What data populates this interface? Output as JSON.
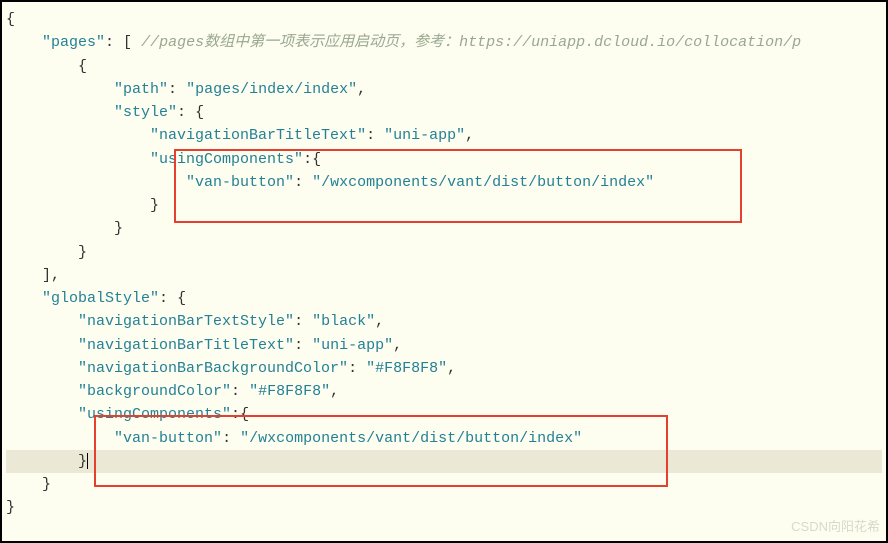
{
  "code": {
    "lines": [
      {
        "indent": 0,
        "tokens": [
          {
            "t": "punct",
            "v": "{"
          }
        ]
      },
      {
        "indent": 1,
        "tokens": [
          {
            "t": "key",
            "v": "\"pages\""
          },
          {
            "t": "colon",
            "v": ": "
          },
          {
            "t": "punct",
            "v": "[ "
          },
          {
            "t": "comment",
            "v": "//pages数组中第一项表示应用启动页，参考：https://uniapp.dcloud.io/collocation/p"
          }
        ]
      },
      {
        "indent": 2,
        "tokens": [
          {
            "t": "punct",
            "v": "{"
          }
        ]
      },
      {
        "indent": 3,
        "tokens": [
          {
            "t": "key",
            "v": "\"path\""
          },
          {
            "t": "colon",
            "v": ": "
          },
          {
            "t": "string",
            "v": "\"pages/index/index\""
          },
          {
            "t": "punct",
            "v": ","
          }
        ]
      },
      {
        "indent": 3,
        "tokens": [
          {
            "t": "key",
            "v": "\"style\""
          },
          {
            "t": "colon",
            "v": ": "
          },
          {
            "t": "punct",
            "v": "{"
          }
        ]
      },
      {
        "indent": 4,
        "tokens": [
          {
            "t": "key",
            "v": "\"navigationBarTitleText\""
          },
          {
            "t": "colon",
            "v": ": "
          },
          {
            "t": "string",
            "v": "\"uni-app\""
          },
          {
            "t": "punct",
            "v": ","
          }
        ]
      },
      {
        "indent": 4,
        "tokens": [
          {
            "t": "key",
            "v": "\"usingComponents\""
          },
          {
            "t": "colon",
            "v": ":"
          },
          {
            "t": "punct",
            "v": "{"
          }
        ]
      },
      {
        "indent": 5,
        "tokens": [
          {
            "t": "key",
            "v": "\"van-button\""
          },
          {
            "t": "colon",
            "v": ": "
          },
          {
            "t": "string",
            "v": "\"/wxcomponents/vant/dist/button/index\""
          }
        ]
      },
      {
        "indent": 4,
        "tokens": [
          {
            "t": "punct",
            "v": "}"
          }
        ]
      },
      {
        "indent": 3,
        "tokens": [
          {
            "t": "punct",
            "v": "}"
          }
        ]
      },
      {
        "indent": 2,
        "tokens": [
          {
            "t": "punct",
            "v": "}"
          }
        ]
      },
      {
        "indent": 1,
        "tokens": [
          {
            "t": "punct",
            "v": "],"
          }
        ]
      },
      {
        "indent": 1,
        "tokens": [
          {
            "t": "key",
            "v": "\"globalStyle\""
          },
          {
            "t": "colon",
            "v": ": "
          },
          {
            "t": "punct",
            "v": "{"
          }
        ]
      },
      {
        "indent": 2,
        "tokens": [
          {
            "t": "key",
            "v": "\"navigationBarTextStyle\""
          },
          {
            "t": "colon",
            "v": ": "
          },
          {
            "t": "string",
            "v": "\"black\""
          },
          {
            "t": "punct",
            "v": ","
          }
        ]
      },
      {
        "indent": 2,
        "tokens": [
          {
            "t": "key",
            "v": "\"navigationBarTitleText\""
          },
          {
            "t": "colon",
            "v": ": "
          },
          {
            "t": "string",
            "v": "\"uni-app\""
          },
          {
            "t": "punct",
            "v": ","
          }
        ]
      },
      {
        "indent": 2,
        "tokens": [
          {
            "t": "key",
            "v": "\"navigationBarBackgroundColor\""
          },
          {
            "t": "colon",
            "v": ": "
          },
          {
            "t": "string",
            "v": "\"#F8F8F8\""
          },
          {
            "t": "punct",
            "v": ","
          }
        ]
      },
      {
        "indent": 2,
        "tokens": [
          {
            "t": "key",
            "v": "\"backgroundColor\""
          },
          {
            "t": "colon",
            "v": ": "
          },
          {
            "t": "string",
            "v": "\"#F8F8F8\""
          },
          {
            "t": "punct",
            "v": ","
          }
        ]
      },
      {
        "indent": 2,
        "tokens": [
          {
            "t": "key",
            "v": "\"usingComponents\""
          },
          {
            "t": "colon",
            "v": ":"
          },
          {
            "t": "punct",
            "v": "{"
          }
        ]
      },
      {
        "indent": 3,
        "tokens": [
          {
            "t": "key",
            "v": "\"van-button\""
          },
          {
            "t": "colon",
            "v": ": "
          },
          {
            "t": "string",
            "v": "\"/wxcomponents/vant/dist/button/index\""
          }
        ]
      },
      {
        "indent": 2,
        "highlight": true,
        "cursor": true,
        "tokens": [
          {
            "t": "punct",
            "v": "}"
          }
        ]
      },
      {
        "indent": 1,
        "tokens": [
          {
            "t": "punct",
            "v": "}"
          }
        ]
      },
      {
        "indent": 0,
        "tokens": [
          {
            "t": "punct",
            "v": "}"
          }
        ]
      }
    ]
  },
  "watermark": "CSDN向阳花希"
}
